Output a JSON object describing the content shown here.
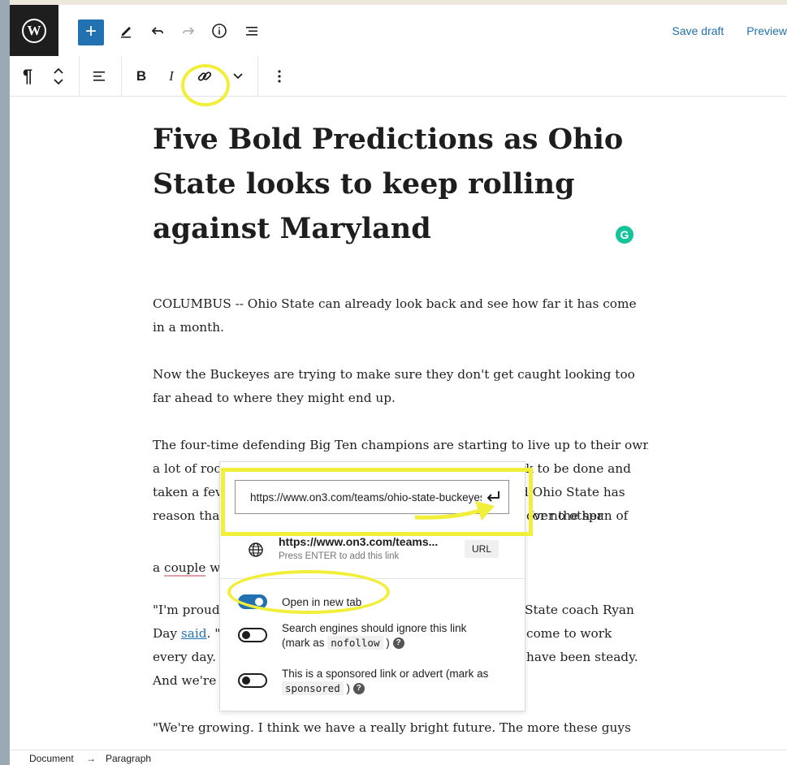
{
  "header": {
    "add_icon": "plus-icon",
    "save_draft": "Save draft",
    "preview": "Preview"
  },
  "post": {
    "title": "Five Bold Predictions as Ohio State looks to keep rolling against Maryland",
    "p1": "COLUMBUS -- Ohio State can already look back and see how far it has come in a month.",
    "p2": "Now the Buckeyes are trying to make sure they don't get caught looking too far ahead to where they might end up.",
    "p3a": "The four-time defending Big Ten champions are starting to live up to their own expec",
    "p3b": "rk to be done and",
    "p3c": "a lot of roo",
    "p3d": "d Ohio State has",
    "p3e": "taken a fev",
    "p3f": "for no other",
    "p3g": "reason tha",
    "p3h": "over the span of",
    "p3i": "a",
    "p3j": "couple",
    "p3k": "w",
    "p4a": "\"I'm proud",
    "p4b": "State coach Ryan",
    "p4c": "Day",
    "p4d": "said",
    "p4e": ". \"",
    "p4f": "come to work",
    "p4g": "every day.",
    "p4h": "have been steady.",
    "p4i": "And we're",
    "p5": "\"We're growing. I think we have a really bright future. The more these guys"
  },
  "link_popover": {
    "url_value": "https://www.on3.com/teams/ohio-state-buckeyes/",
    "suggestion_title": "https://www.on3.com/teams...",
    "suggestion_subtitle": "Press ENTER to add this link",
    "suggestion_badge": "URL",
    "open_new_tab_label": "Open in new tab",
    "open_new_tab_on": true,
    "nofollow_label_a": "Search engines should ignore this link",
    "nofollow_label_b": "(mark as",
    "nofollow_code": "nofollow",
    "nofollow_label_c": ")",
    "sponsored_label_a": "This is a sponsored link or advert (mark as",
    "sponsored_code": "sponsored",
    "sponsored_label_b": ")",
    "help_glyph": "?"
  },
  "statusbar": {
    "document": "Document",
    "arrow": "→",
    "paragraph": "Paragraph"
  },
  "colors": {
    "accent": "#2271b1",
    "highlight": "#f2ef3a",
    "grammarly": "#15c39a"
  }
}
